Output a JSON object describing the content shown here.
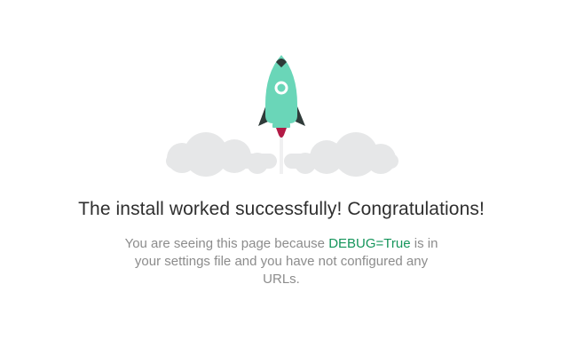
{
  "hero": {
    "icon": "rocket-icon",
    "cloud_icon": "cloud-icon",
    "colors": {
      "rocket_body": "#6ad6b8",
      "rocket_fins": "#2f3b39",
      "rocket_exhaust": "#b21a45",
      "clouds": "#e6e7e8",
      "trail": "#f0f0f1"
    }
  },
  "title": "The install worked successfully! Congratulations!",
  "description": {
    "before": "You are seeing this page because ",
    "highlight": "DEBUG=True",
    "after": " is in your settings file and you have not configured any URLs."
  },
  "colors": {
    "title": "#2f2f2f",
    "text": "#8c8c8c",
    "highlight": "#15955b"
  }
}
